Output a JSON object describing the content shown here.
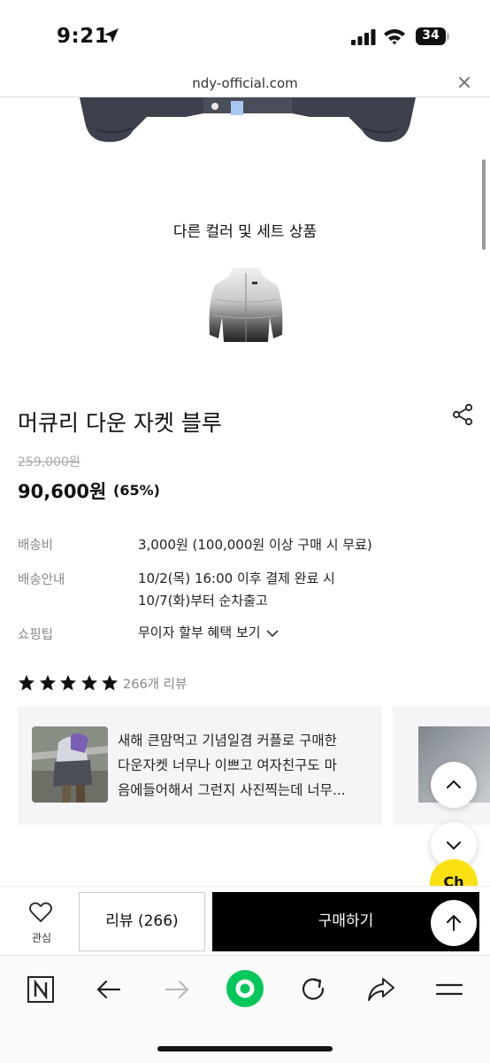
{
  "status_bar": {
    "time": "9:21",
    "battery": "34"
  },
  "browser": {
    "url": "ndy-official.com"
  },
  "section": {
    "other_colors_title": "다른 컬러 및 세트 상품"
  },
  "product": {
    "title": "머큐리 다운 자켓 블루",
    "original_price": "259,000원",
    "sale_price": "90,600원",
    "discount": "(65%)"
  },
  "info": {
    "shipping_fee_label": "배송비",
    "shipping_fee_value": "3,000원 (100,000원 이상 구매 시 무료)",
    "delivery_label": "배송안내",
    "delivery_line1": "10/2(목) 16:00 이후 결제 완료 시",
    "delivery_line2": "10/7(화)부터 순차출고",
    "tip_label": "쇼핑팁",
    "tip_value": "무이자 할부 혜택 보기"
  },
  "rating": {
    "stars": 5,
    "review_count_text": "266개 리뷰"
  },
  "review": {
    "line1": "새해 큰맘먹고 기념일겸 커플로 구매한",
    "line2": "다운자켓 너무나 이쁘고 여자친구도 마",
    "line3": "음에들어해서 그런지 사진찍는데 너무..."
  },
  "floating": {
    "channel_label": "Ch"
  },
  "action_bar": {
    "like_label": "관심",
    "review_button": "리뷰 (266)",
    "buy_button": "구매하기"
  },
  "colors": {
    "buy_bg": "#000000",
    "channel_bg": "#fbe012",
    "naver_green": "#03c75a"
  }
}
